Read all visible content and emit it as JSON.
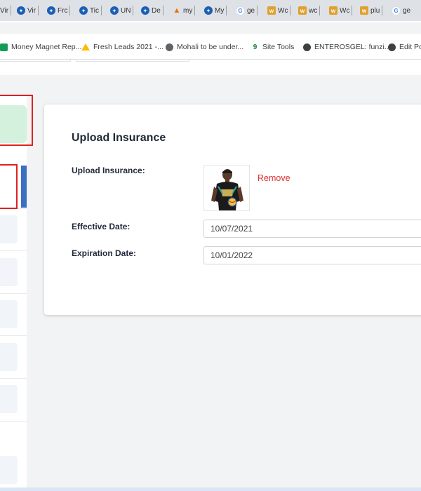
{
  "browser": {
    "tabs": [
      {
        "label": "Vir",
        "icon": "globe-icon"
      },
      {
        "label": "Vir",
        "icon": "globe-icon"
      },
      {
        "label": "Frc",
        "icon": "globe-icon"
      },
      {
        "label": "Tic",
        "icon": "globe-icon"
      },
      {
        "label": "UN",
        "icon": "globe-icon"
      },
      {
        "label": "De",
        "icon": "globe-icon"
      },
      {
        "label": "my",
        "icon": "flame-icon"
      },
      {
        "label": "My",
        "icon": "globe-icon"
      },
      {
        "label": "ge",
        "icon": "google-icon"
      },
      {
        "label": "Wc",
        "icon": "wolf-icon"
      },
      {
        "label": "wc",
        "icon": "wolf-icon"
      },
      {
        "label": "Wc",
        "icon": "wolf-icon"
      },
      {
        "label": "plu",
        "icon": "wolf-icon"
      },
      {
        "label": "ge",
        "icon": "google-icon"
      }
    ],
    "bookmarks": [
      {
        "label": "Money Magnet Rep...",
        "icon": "sheets-icon"
      },
      {
        "label": "Fresh Leads 2021 -...",
        "icon": "drive-icon"
      },
      {
        "label": "Mohali to be under...",
        "icon": "globe-icon"
      },
      {
        "label": "Site Tools",
        "icon": "site-tools-icon"
      },
      {
        "label": "ENTEROSGEL: funzi...",
        "icon": "dark-globe-icon"
      },
      {
        "label": "Edit Po",
        "icon": "dark-globe-icon"
      }
    ]
  },
  "card": {
    "title": "Upload Insurance",
    "upload_label": "Upload Insurance:",
    "remove_label": "Remove",
    "effective_label": "Effective Date:",
    "effective_value": "10/07/2021",
    "expiration_label": "Expiration Date:",
    "expiration_value": "10/01/2022"
  },
  "colors": {
    "remove": "#e03131",
    "annotation": "#e02020",
    "sidebar_active": "#d4f1de",
    "sidebar_marker": "#3a6fc2"
  }
}
